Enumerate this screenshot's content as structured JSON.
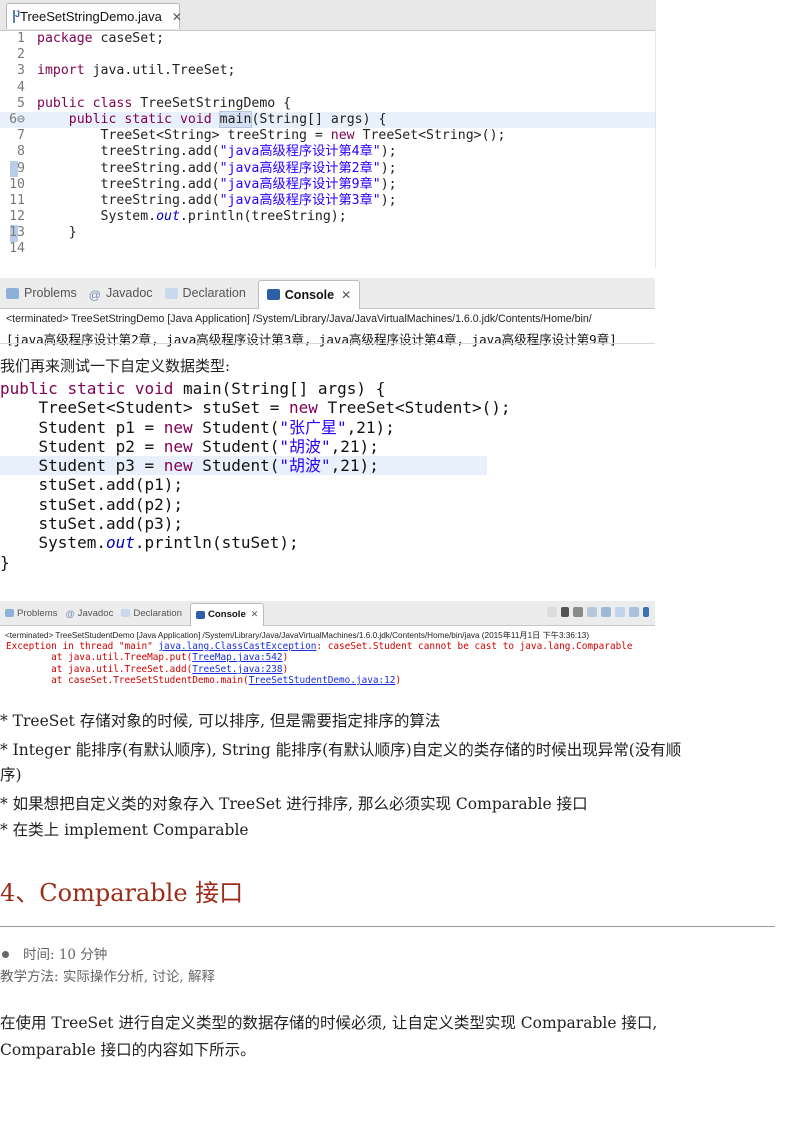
{
  "editor": {
    "tab_label": "TreeSetStringDemo.java",
    "lines": [
      {
        "n": "1",
        "t": "package caseSet;"
      },
      {
        "n": "2",
        "t": ""
      },
      {
        "n": "3",
        "t": "import java.util.TreeSet;"
      },
      {
        "n": "4",
        "t": ""
      },
      {
        "n": "5",
        "t": "public class TreeSetStringDemo {"
      },
      {
        "n": "6⊖",
        "t": "    public static void main(String[] args) {"
      },
      {
        "n": "7",
        "t": "        TreeSet<String> treeString = new TreeSet<String>();"
      },
      {
        "n": "8",
        "t": "        treeString.add(\"java高级程序设计第4章\");"
      },
      {
        "n": "9",
        "t": "        treeString.add(\"java高级程序设计第2章\");"
      },
      {
        "n": "10",
        "t": "        treeString.add(\"java高级程序设计第9章\");"
      },
      {
        "n": "11",
        "t": "        treeString.add(\"java高级程序设计第3章\");"
      },
      {
        "n": "12",
        "t": "        System.out.println(treeString);"
      },
      {
        "n": "13",
        "t": "    }"
      },
      {
        "n": "14",
        "t": ""
      }
    ]
  },
  "console1": {
    "tabs": [
      "Problems",
      "Javadoc",
      "Declaration",
      "Console"
    ],
    "terminated": "<terminated> TreeSetStringDemo [Java Application] /System/Library/Java/JavaVirtualMachines/1.6.0.jdk/Contents/Home/bin/",
    "output": "[java高级程序设计第2章, java高级程序设计第3章, java高级程序设计第4章, java高级程序设计第9章]"
  },
  "text1": "我们再来测试一下自定义数据类型:",
  "code2": [
    "public static void main(String[] args) {",
    "    TreeSet<Student> stuSet = new TreeSet<Student>();",
    "    Student p1 = new Student(\"张广星\",21);",
    "    Student p2 = new Student(\"胡波\",21);",
    "    Student p3 = new Student(\"胡波\",21);",
    "    stuSet.add(p1);",
    "    stuSet.add(p2);",
    "    stuSet.add(p3);",
    "    System.out.println(stuSet);",
    "}"
  ],
  "console2": {
    "tabs": [
      "Problems",
      "Javadoc",
      "Declaration",
      "Console"
    ],
    "terminated": "<terminated> TreeSetStudentDemo [Java Application] /System/Library/Java/JavaVirtualMachines/1.6.0.jdk/Contents/Home/bin/java (2015年11月1日 下午3:36:13)",
    "err_prefix": "Exception in thread \"main\" ",
    "err_exception": "java.lang.ClassCastException",
    "err_msg": ": caseSet.Student cannot be cast to java.lang.Comparable",
    "trace": [
      {
        "pre": "        at java.util.TreeMap.put(",
        "link": "TreeMap.java:542",
        "post": ")"
      },
      {
        "pre": "        at java.util.TreeSet.add(",
        "link": "TreeSet.java:238",
        "post": ")"
      },
      {
        "pre": "        at caseSet.TreeSetStudentDemo.main(",
        "link": "TreeSetStudentDemo.java:12",
        "post": ")"
      }
    ]
  },
  "notes": [
    "* TreeSet 存储对象的时候, 可以排序, 但是需要指定排序的算法",
    " * Integer 能排序(有默认顺序), String 能排序(有默认顺序)自定义的类存储的时候出现异常(没有顺",
    "序)",
    " *  如果想把自定义类的对象存入 TreeSet 进行排序, 那么必须实现 Comparable 接口",
    " *     在类上 implement Comparable"
  ],
  "section": {
    "title": "4、Comparable 接口",
    "time": "时间:    10 分钟",
    "method": "教学方法: 实际操作分析, 讨论, 解释",
    "body1": "在使用 TreeSet 进行自定义类型的数据存储的时候必须, 让自定义类型实现 Comparable 接口,",
    "body2": "Comparable 接口的内容如下所示。"
  }
}
